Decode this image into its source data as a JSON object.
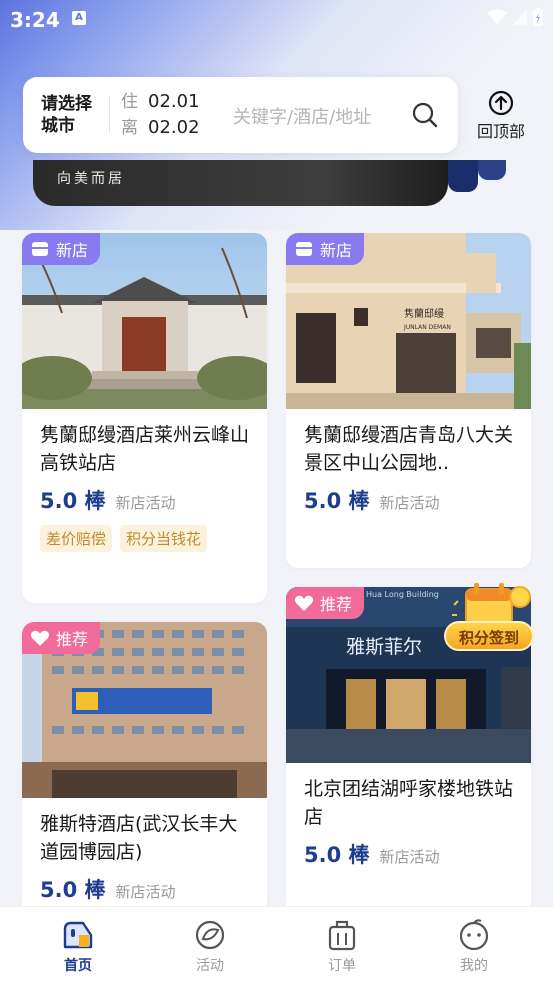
{
  "status": {
    "time": "3:24",
    "notif": "A"
  },
  "search": {
    "city": "请选择城市",
    "checkin_label": "住",
    "checkin": "02.01",
    "checkout_label": "离",
    "checkout": "02.02",
    "keyword_placeholder": "关键字/酒店/地址",
    "to_top": "回顶部"
  },
  "banner": {
    "text": "向美而居"
  },
  "hotels": [
    {
      "badge": "新店",
      "name": "隽蘭邸缦酒店莱州云峰山高铁站店",
      "score": "5.0 棒",
      "activity": "新店活动",
      "tags": [
        "差价赔偿",
        "积分当钱花"
      ]
    },
    {
      "badge": "新店",
      "name": "隽蘭邸缦酒店青岛八大关景区中山公园地..",
      "score": "5.0 棒",
      "activity": "新店活动",
      "tags": []
    },
    {
      "badge": "推荐",
      "name": "雅斯特酒店(武汉长丰大道园博园店)",
      "score": "5.0 棒",
      "activity": "新店活动",
      "tags": []
    },
    {
      "badge": "推荐",
      "name": "北京团结湖呼家楼地铁站店",
      "score": "5.0 棒",
      "activity": "新店活动",
      "tags": []
    }
  ],
  "img_text": {
    "h2_sign": "隽蘭邸缦",
    "h2_sign_en": "JUNLAN DEMAN",
    "h4_sign": "雅斯菲尔",
    "h4_sign_top": "Hua Long Building"
  },
  "points_sign": "积分签到",
  "tabs": [
    {
      "label": "首页",
      "icon": "home-icon",
      "active": true
    },
    {
      "label": "活动",
      "icon": "activity-icon",
      "active": false
    },
    {
      "label": "订单",
      "icon": "order-icon",
      "active": false
    },
    {
      "label": "我的",
      "icon": "profile-icon",
      "active": false
    }
  ],
  "colors": {
    "brand": "#1e3d8f",
    "new_badge": "#8a7af0",
    "rec_badge": "#f06b9a"
  }
}
